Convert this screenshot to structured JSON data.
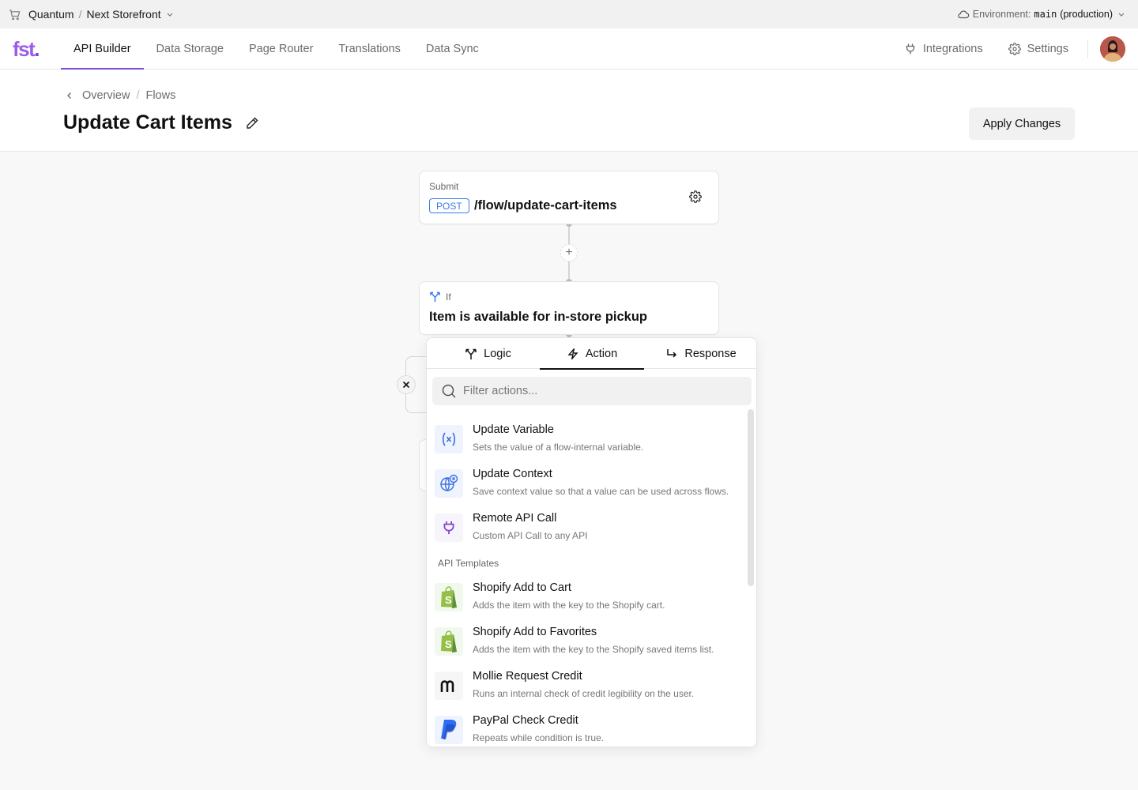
{
  "topbar": {
    "project": "Quantum",
    "separator": "/",
    "storefront": "Next Storefront",
    "environment_label": "Environment:",
    "environment_value": "main",
    "environment_suffix": "(production)"
  },
  "nav": {
    "logo_text": "fst",
    "logo_dot": ".",
    "tabs": [
      {
        "label": "API Builder",
        "active": true
      },
      {
        "label": "Data Storage",
        "active": false
      },
      {
        "label": "Page Router",
        "active": false
      },
      {
        "label": "Translations",
        "active": false
      },
      {
        "label": "Data Sync",
        "active": false
      }
    ],
    "integrations_label": "Integrations",
    "settings_label": "Settings",
    "accent_color": "#7c4ddb"
  },
  "header": {
    "breadcrumb": [
      "Overview",
      "Flows"
    ],
    "breadcrumb_separator": "/",
    "title": "Update Cart Items",
    "apply_label": "Apply Changes"
  },
  "flow": {
    "submit_node": {
      "label": "Submit",
      "method": "POST",
      "path": "/flow/update-cart-items"
    },
    "add_step_symbol": "+",
    "if_node": {
      "label": "If",
      "condition": "Item is available for in-store pickup"
    }
  },
  "popover": {
    "tabs": [
      {
        "label": "Logic",
        "icon": "split-icon",
        "active": false
      },
      {
        "label": "Action",
        "icon": "lightning-icon",
        "active": true
      },
      {
        "label": "Response",
        "icon": "return-arrow-icon",
        "active": false
      }
    ],
    "filter_placeholder": "Filter actions...",
    "filter_value": "",
    "actions": [
      {
        "name": "Update Variable",
        "description": "Sets the value of a flow-internal variable.",
        "icon": "variable-icon"
      },
      {
        "name": "Update Context",
        "description": "Save context value so that a value can be used across flows.",
        "icon": "globe-variable-icon"
      },
      {
        "name": "Remote API Call",
        "description": "Custom API Call to any API",
        "icon": "plug-icon"
      }
    ],
    "templates_section": "API Templates",
    "templates": [
      {
        "name": "Shopify Add to Cart",
        "description": "Adds the item with the key to the Shopify cart.",
        "icon": "shopify-icon"
      },
      {
        "name": "Shopify Add to Favorites",
        "description": "Adds the item with the key to the Shopify saved items list.",
        "icon": "shopify-icon"
      },
      {
        "name": "Mollie Request Credit",
        "description": "Runs an internal check of credit legibility on the user.",
        "icon": "mollie-icon"
      },
      {
        "name": "PayPal Check Credit",
        "description": "Repeats while condition is true.",
        "icon": "paypal-icon"
      }
    ]
  }
}
